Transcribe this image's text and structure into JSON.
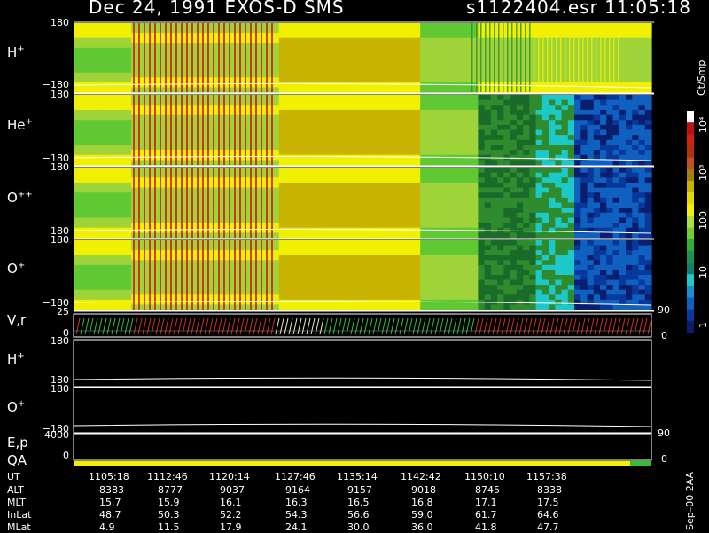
{
  "header": {
    "title": "Dec 24, 1991   EXOS-D SMS",
    "file_time": "s1122404.esr  11:05:18"
  },
  "panels": [
    {
      "label": "H",
      "sup": "+",
      "ymax": "180",
      "ymin": "−180"
    },
    {
      "label": "He",
      "sup": "+",
      "ymax": "180",
      "ymin": "−180"
    },
    {
      "label": "O",
      "sup": "++",
      "ymax": "180",
      "ymin": "−180"
    },
    {
      "label": "O",
      "sup": "+",
      "ymax": "180",
      "ymin": "−180"
    }
  ],
  "vr_panel": {
    "label": "V,r",
    "ymax": "25",
    "ymin": "0",
    "right_max": "90",
    "right_min": "0"
  },
  "lower_panels": [
    {
      "label": "H",
      "sup": "+",
      "ymax": "180",
      "ymin": "−180"
    },
    {
      "label": "O",
      "sup": "+",
      "ymax": "180",
      "ymin": "−180"
    }
  ],
  "ep_panel": {
    "label1": "E,p",
    "label2": "QA",
    "ymax": "4000",
    "ymin": "0",
    "right_max": "90",
    "right_min": "0"
  },
  "colorbar": {
    "unit": "Ct/Smp",
    "ticks": [
      "10⁴",
      "10³",
      "100",
      "10",
      "1"
    ]
  },
  "footer_stamp": "Sep–00  2AA",
  "ephemeris": {
    "rows": [
      {
        "name": "UT",
        "values": [
          "1105:18",
          "1112:46",
          "1120:14",
          "1127:46",
          "1135:14",
          "1142:42",
          "1150:10",
          "1157:38"
        ]
      },
      {
        "name": "ALT",
        "values": [
          "8383",
          "8777",
          "9037",
          "9164",
          "9157",
          "9018",
          "8745",
          "8338"
        ]
      },
      {
        "name": "MLT",
        "values": [
          "15.7",
          "15.9",
          "16.1",
          "16.3",
          "16.5",
          "16.8",
          "17.1",
          "17.5"
        ]
      },
      {
        "name": "InLat",
        "values": [
          "48.7",
          "50.3",
          "52.2",
          "54.3",
          "56.6",
          "59.0",
          "61.7",
          "64.6"
        ]
      },
      {
        "name": "MLat",
        "values": [
          "4.9",
          "11.5",
          "17.9",
          "24.1",
          "30.0",
          "36.0",
          "41.8",
          "47.7"
        ]
      }
    ]
  },
  "chart_data": {
    "type": "heatmap",
    "title": "Dec 24, 1991   EXOS-D SMS",
    "x_label": "UT",
    "x_ticks": [
      "1105:18",
      "1112:46",
      "1120:14",
      "1127:46",
      "1135:14",
      "1142:42",
      "1150:10",
      "1157:38"
    ],
    "y_range": [
      -180,
      180
    ],
    "color_scale": "log",
    "color_range_counts": [
      1,
      10000
    ],
    "series": [
      {
        "name": "H+",
        "pattern": "green-yellow background, red striped interval near start, striped near end"
      },
      {
        "name": "He+",
        "pattern": "green to yellow, then dark green and blue toward end"
      },
      {
        "name": "O++",
        "pattern": "green to yellow, blue/cyan toward end"
      },
      {
        "name": "O+",
        "pattern": "green to yellow, dark green/blue toward end"
      }
    ]
  }
}
